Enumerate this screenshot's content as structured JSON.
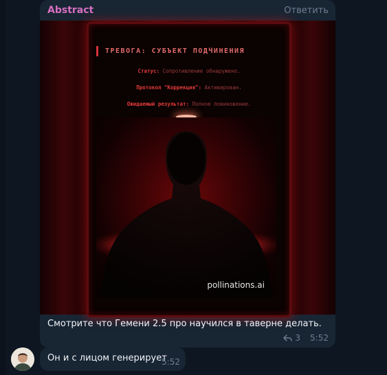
{
  "message1": {
    "sender": "Abstract",
    "reply_label": "Ответить",
    "image": {
      "alert_title": "ТРЕВОГА: СУБЪЕКТ ПОДЧИНЕНИЯ",
      "status_key": "Статус:",
      "status_value": "Сопротивление обнаружено.",
      "protocol_key": "Протокол \"Коррекция\":",
      "protocol_value": "Активирован.",
      "expected_key": "Ожидаемый результат:",
      "expected_value": "Полное повиновение.",
      "watermark": "pollinations.ai"
    },
    "caption": "Смотрите что Гемени 2.5 про научился в таверне делать.",
    "reply_count": "3",
    "time": "5:52"
  },
  "message2": {
    "text": "Он и с лицом генерирует",
    "time": "5:52"
  },
  "colors": {
    "background": "#0e1621",
    "bubble": "#182533",
    "sender": "#d76fc2",
    "meta": "#6e7f92",
    "text": "#f1f5f9",
    "alert_red": "#e03a3a"
  },
  "icons": [
    "reply-arrow-icon",
    "avatar-image"
  ]
}
